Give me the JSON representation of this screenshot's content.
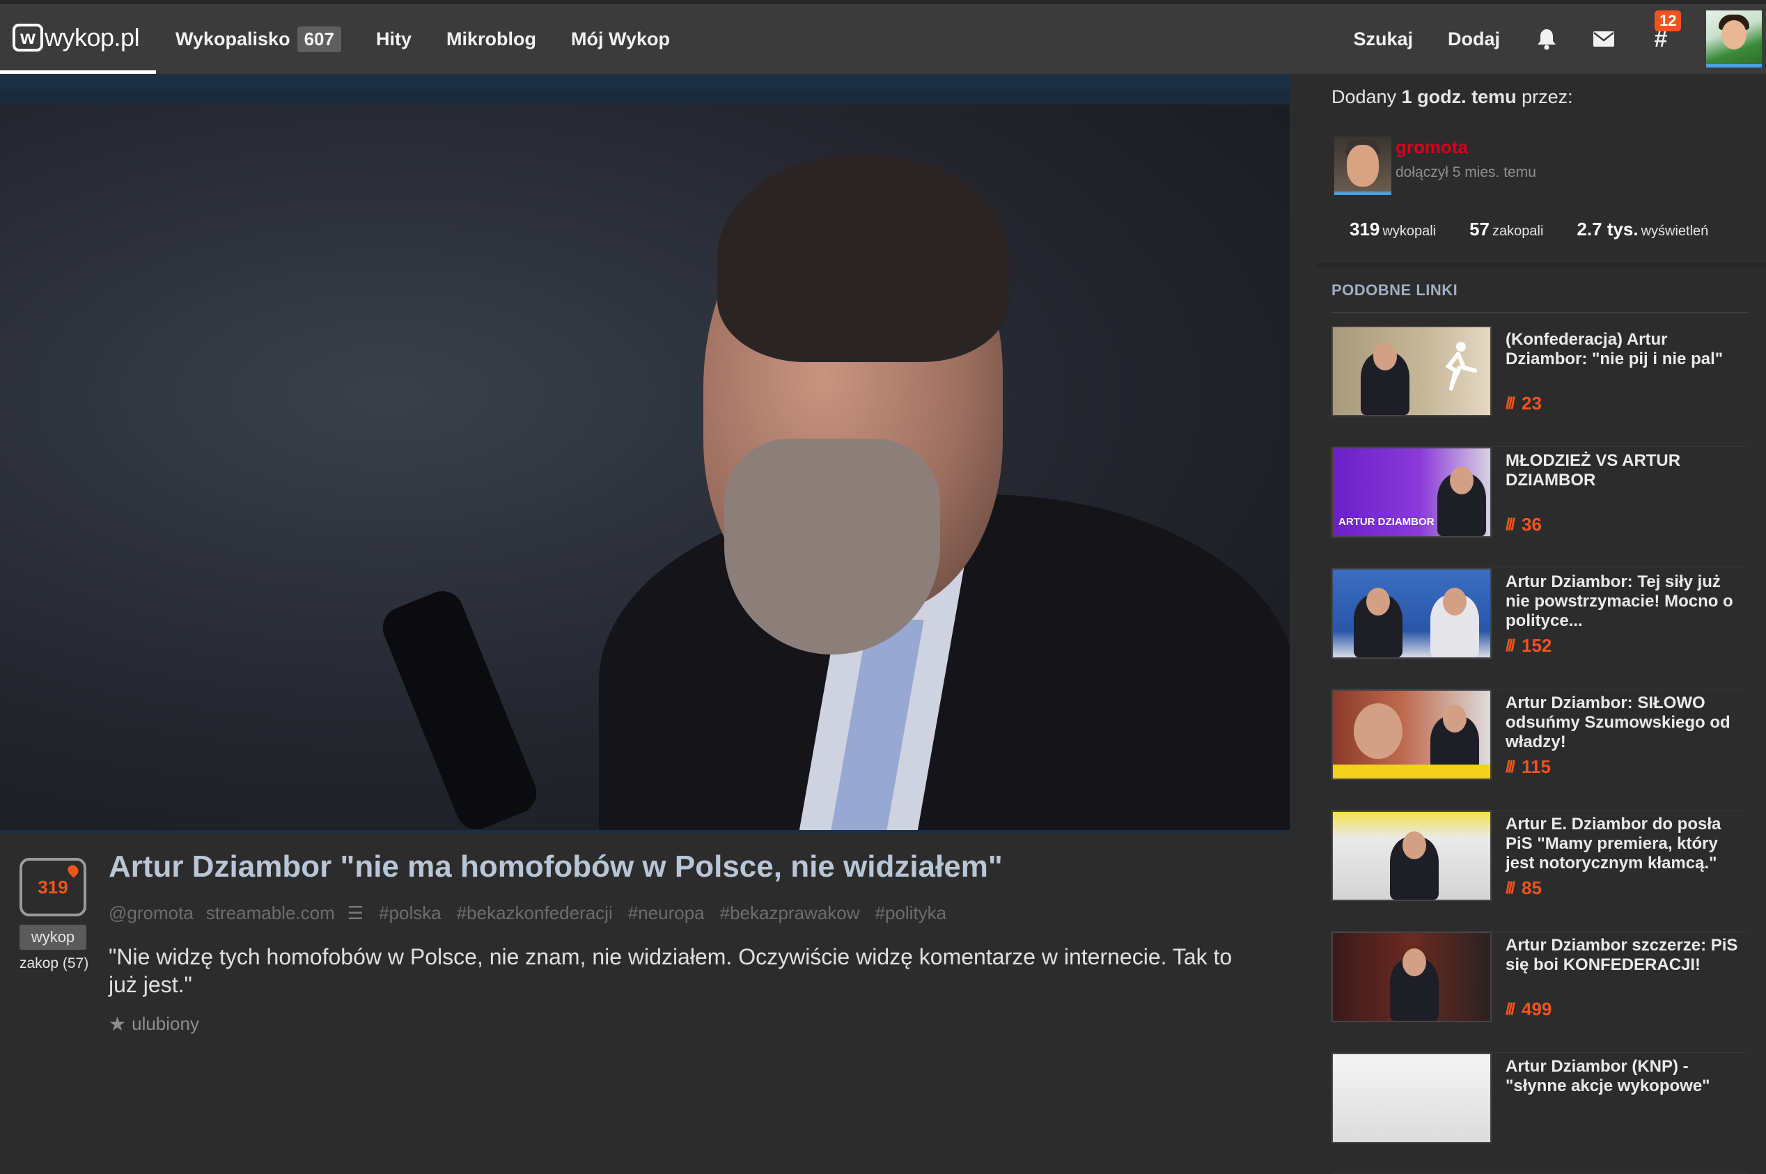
{
  "header": {
    "logo_text": "wykop.pl",
    "logo_mark": "w",
    "nav": [
      {
        "label": "Wykopalisko",
        "badge": "607"
      },
      {
        "label": "Hity"
      },
      {
        "label": "Mikroblog"
      },
      {
        "label": "Mój Wykop"
      }
    ],
    "search_label": "Szukaj",
    "add_label": "Dodaj",
    "hashtag_glyph": "#",
    "hashtag_badge": "12"
  },
  "link": {
    "votes": "319",
    "vote_button": "wykop",
    "bury": "zakop (57)",
    "title": "Artur Dziambor \"nie ma homofobów w Polsce, nie widziałem\"",
    "author_handle": "@gromota",
    "source": "streamable.com",
    "tags": [
      "#polska",
      "#bekazkonfederacji",
      "#neuropa",
      "#bekazprawakow",
      "#polityka"
    ],
    "description": "\"Nie widzę tych homofobów w Polsce, nie znam, nie widziałem. Oczywiście widzę komentarze w internecie. Tak to już jest.\"",
    "favorite_label": "ulubiony"
  },
  "sidebar": {
    "added_prefix": "Dodany",
    "added_time": "1 godz. temu",
    "added_suffix": "przez:",
    "author_name": "gromota",
    "author_joined": "dołączył 5 mies. temu",
    "stats": [
      {
        "value": "319",
        "label": "wykopali"
      },
      {
        "value": "57",
        "label": "zakopali"
      },
      {
        "value": "2.7 tys.",
        "label": "wyświetleń"
      }
    ],
    "similar_heading": "PODOBNE LINKI",
    "similar": [
      {
        "title": "(Konfederacja) Artur Dziambor: \"nie pij i nie pal\"",
        "score": "23"
      },
      {
        "title": "MŁODZIEŻ VS ARTUR DZIAMBOR",
        "score": "36",
        "thumb_text": "ARTUR DZIAMBOR"
      },
      {
        "title": "Artur Dziambor: Tej siły już nie powstrzymacie! Mocno o polityce...",
        "score": "152"
      },
      {
        "title": "Artur Dziambor: SIŁOWO odsuńmy Szumowskiego od władzy!",
        "score": "115"
      },
      {
        "title": "Artur E. Dziambor do posła PiS \"Mamy premiera, który jest notorycznym kłamcą.\"",
        "score": "85"
      },
      {
        "title": "Artur Dziambor szczerze: PiS się boi KONFEDERACJI!",
        "score": "499"
      },
      {
        "title": "Artur Dziambor (KNP) - \"słynne akcje wykopowe\"",
        "score": ""
      }
    ]
  }
}
